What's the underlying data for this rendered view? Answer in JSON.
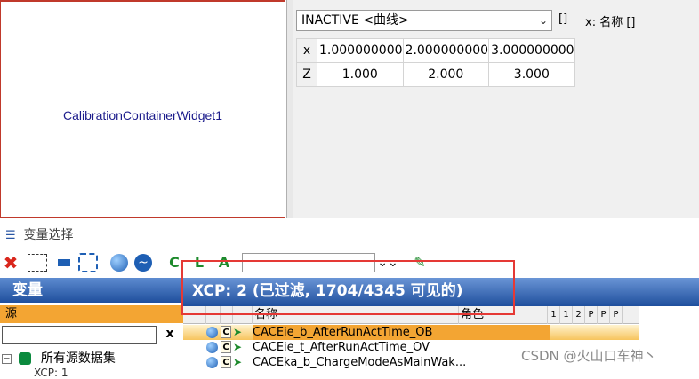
{
  "calibration_widget": {
    "label": "CalibrationContainerWidget1"
  },
  "curve_panel": {
    "mode_select": "INACTIVE <曲线>",
    "bracket_text": "[]",
    "x_name_text": "x: 名称 []",
    "rows": [
      {
        "label": "x",
        "values": [
          "1.000000000",
          "2.000000000",
          "3.000000000"
        ]
      },
      {
        "label": "Z",
        "values": [
          "1.000",
          "2.000",
          "3.000"
        ]
      }
    ]
  },
  "variable_selector": {
    "title": "变量选择",
    "toolbar": {
      "c_label": "C",
      "l_label": "L",
      "a_label": "A",
      "filter_value": ""
    },
    "variables_header": "变量",
    "xcp_header": "XCP: 2 (已过滤, 1704/4345 可见的)",
    "source_header": "源",
    "source_input": "",
    "clear_label": "x",
    "tree_root": "所有源数据集",
    "tree_child": "XCP: 1",
    "columns": {
      "name": "名称",
      "role": "角色",
      "flags": [
        "1",
        "1",
        "2",
        "P",
        "P",
        "P"
      ]
    },
    "rows": [
      {
        "name": "CACEie_b_AfterRunActTime_OB",
        "selected": true
      },
      {
        "name": "CACEie_t_AfterRunActTime_OV",
        "selected": false
      },
      {
        "name": "CACEka_b_ChargeModeAsMainWak...",
        "selected": false
      }
    ]
  },
  "watermark": "CSDN @火山口车神丶",
  "colors": {
    "header_blue": "#1f4f9d",
    "highlight_red": "#e53935",
    "selected_orange": "#f3a533"
  }
}
